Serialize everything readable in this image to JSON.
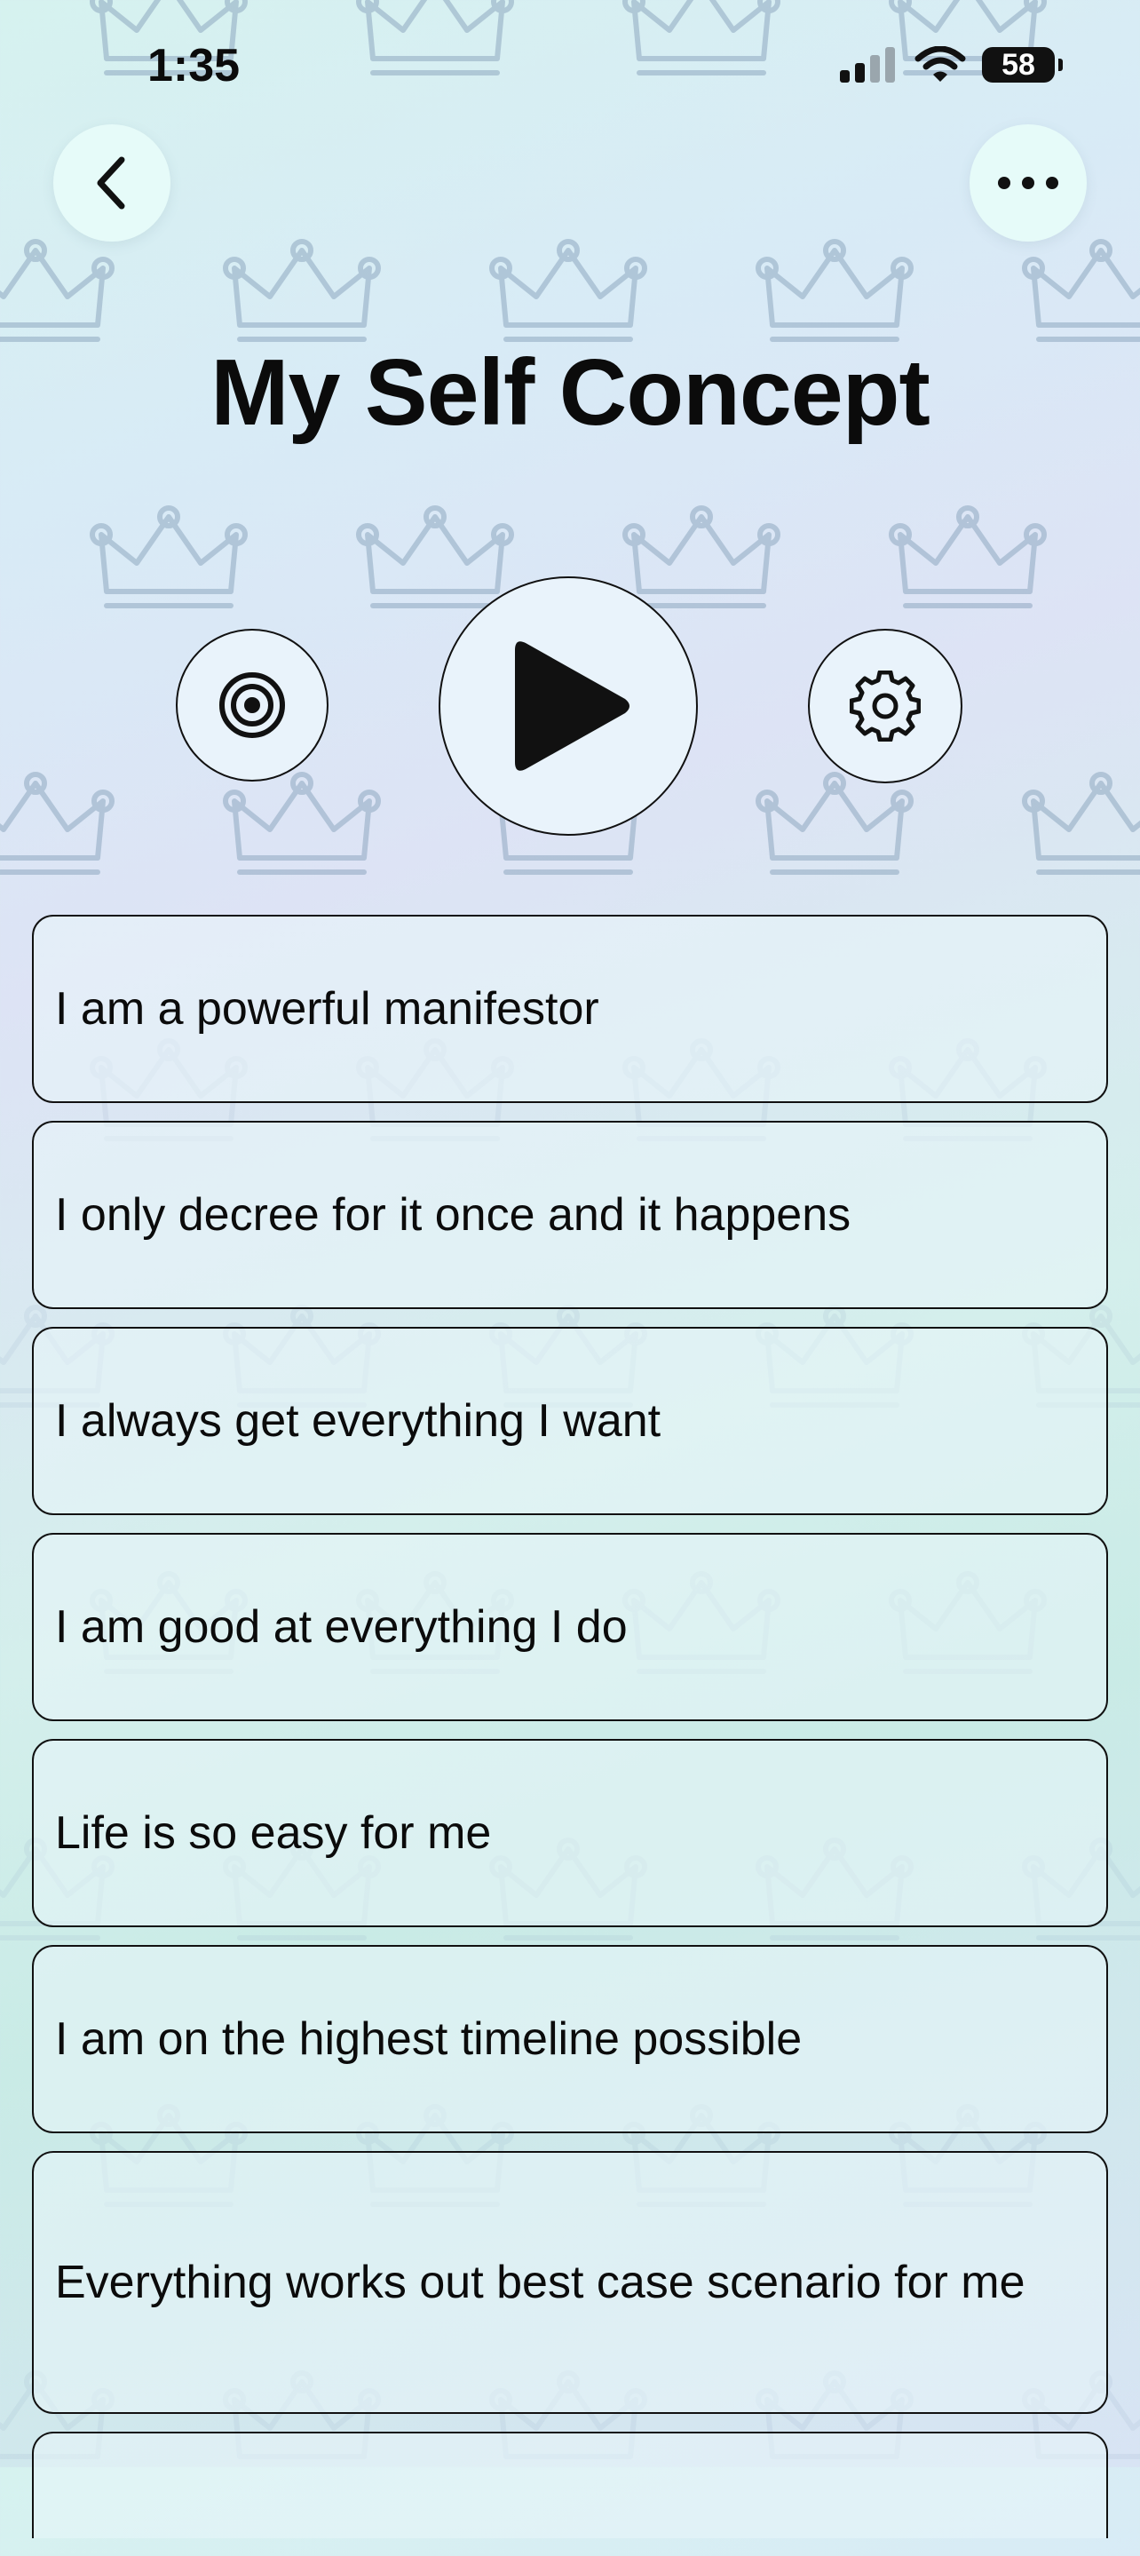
{
  "status_bar": {
    "time": "1:35",
    "battery": "58"
  },
  "header": {
    "title": "My Self Concept"
  },
  "controls": {
    "target_icon": "target-icon",
    "play_icon": "play-icon",
    "settings_icon": "gear-icon"
  },
  "affirmations": [
    "I am a powerful manifestor",
    "I only decree for it once and it happens",
    "I always get everything I want",
    "I am good at everything I do",
    "Life is so easy for me",
    "I am on the highest timeline possible",
    "Everything works out best case scenario for me"
  ],
  "colors": {
    "crown_stroke": "#8fa8c0",
    "button_fill": "#e9f3fb",
    "top_button_fill": "#e6fbf9",
    "text": "#0b0b0b"
  }
}
